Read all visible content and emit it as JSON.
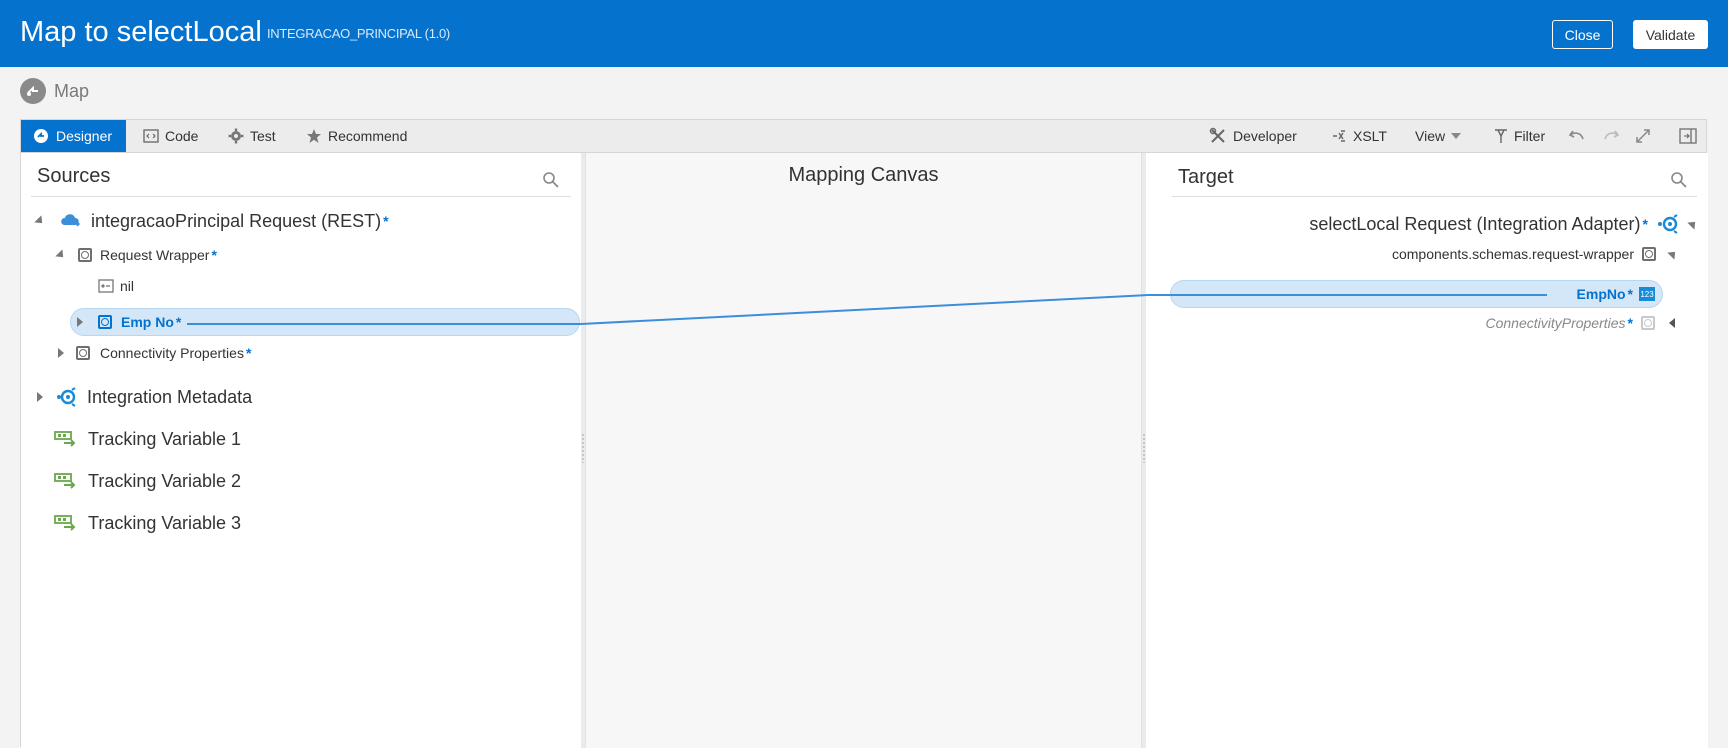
{
  "header": {
    "title": "Map to selectLocal",
    "subtitle": "INTEGRACAO_PRINCIPAL (1.0)",
    "close_label": "Close",
    "validate_label": "Validate"
  },
  "breadcrumb": {
    "label": "Map"
  },
  "toolbar": {
    "tabs": [
      {
        "label": "Designer",
        "icon": "designer-icon",
        "active": true
      },
      {
        "label": "Code",
        "icon": "code-icon"
      },
      {
        "label": "Test",
        "icon": "gear-icon"
      },
      {
        "label": "Recommend",
        "icon": "star-icon"
      }
    ],
    "right": [
      {
        "label": "Developer",
        "icon": "tools-icon"
      },
      {
        "label": "XSLT",
        "icon": "xslt-icon"
      },
      {
        "label": "View",
        "icon": "chevron-down-icon"
      },
      {
        "label": "Filter",
        "icon": "filter-icon"
      }
    ]
  },
  "sources": {
    "title": "Sources",
    "root": {
      "label": "integracaoPrincipal Request (REST)",
      "required": "*"
    },
    "request_wrapper": {
      "label": "Request Wrapper",
      "required": "*"
    },
    "nil": {
      "label": "nil"
    },
    "emp_no": {
      "label": "Emp No",
      "required": "*"
    },
    "connectivity": {
      "label": "Connectivity Properties",
      "required": "*"
    },
    "integration_metadata": {
      "label": "Integration Metadata"
    },
    "tracking": [
      {
        "label": "Tracking Variable 1"
      },
      {
        "label": "Tracking Variable 2"
      },
      {
        "label": "Tracking Variable 3"
      }
    ]
  },
  "canvas": {
    "title": "Mapping Canvas"
  },
  "target": {
    "title": "Target",
    "root": {
      "label": "selectLocal Request (Integration Adapter)",
      "required": "*"
    },
    "wrapper": {
      "label": "components.schemas.request-wrapper"
    },
    "empno": {
      "label": "EmpNo",
      "required": "*",
      "type_badge": "123"
    },
    "connectivity": {
      "label": "ConnectivityProperties",
      "required": "*"
    }
  },
  "colors": {
    "header": "#0572ce",
    "accent": "#0572ce",
    "mapping_line": "#3b8fd9",
    "highlight": "#d3e7f8",
    "tracking_icon": "#6aa84f"
  }
}
